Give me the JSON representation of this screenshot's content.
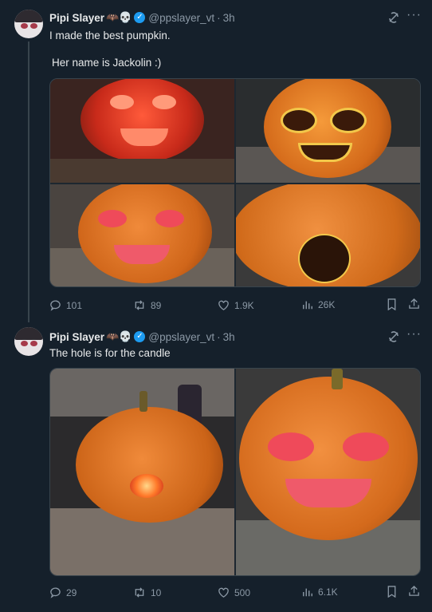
{
  "tweets": [
    {
      "author": {
        "name": "Pipi Slayer",
        "badges": "🦇💀",
        "handle": "@ppslayer_vt",
        "separator": "·",
        "time": "3h"
      },
      "text_lines": [
        "I made the best pumpkin.",
        "Her name is Jackolin :)"
      ],
      "media_alts": [
        "pumpkin-glowing-red-face",
        "pumpkin-carved-face-candle-unlit",
        "pumpkin-painted-pink-face",
        "pumpkin-side-hole"
      ],
      "stats": {
        "replies": "101",
        "reposts": "89",
        "likes": "1.9K",
        "views": "26K"
      }
    },
    {
      "author": {
        "name": "Pipi Slayer",
        "badges": "🦇💀",
        "handle": "@ppslayer_vt",
        "separator": "·",
        "time": "3h"
      },
      "text_lines": [
        "The hole is for the candle"
      ],
      "media_alts": [
        "pumpkin-with-lit-candle-in-hole",
        "pumpkin-face-closeup"
      ],
      "stats": {
        "replies": "29",
        "reposts": "10",
        "likes": "500",
        "views": "6.1K"
      }
    }
  ],
  "colors": {
    "background": "#15202b",
    "text": "#e7e9ea",
    "muted": "#8b98a5",
    "verified": "#1d9bf0",
    "border": "#38444d"
  },
  "icons": [
    "grok-icon",
    "more-icon",
    "reply-icon",
    "repost-icon",
    "like-icon",
    "views-icon",
    "bookmark-icon",
    "share-icon",
    "verified-icon"
  ]
}
